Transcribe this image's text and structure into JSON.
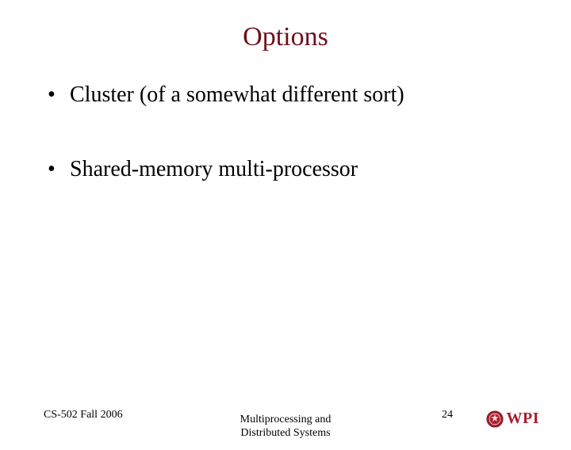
{
  "title": "Options",
  "bullets": [
    "Cluster (of a somewhat different sort)",
    "Shared-memory multi-processor"
  ],
  "footer": {
    "left": "CS-502 Fall 2006",
    "center_line1": "Multiprocessing and",
    "center_line2": "Distributed Systems",
    "page": "24",
    "logo_text": "WPI"
  },
  "colors": {
    "title": "#6e0f1a",
    "brand": "#a81e2d"
  }
}
